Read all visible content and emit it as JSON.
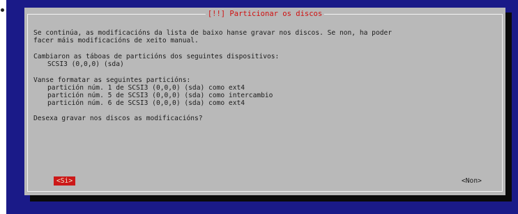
{
  "dialog": {
    "title": "[!!] Particionar os discos",
    "intro_line1": "Se continúa, as modificacións da lista de baixo hanse gravar nos discos. Se non, ha poder",
    "intro_line2": "facer máis modificacións de xeito manual.",
    "tables_heading": "Cambiaron as táboas de particións dos seguintes dispositivos:",
    "tables_device": "SCSI3 (0,0,0) (sda)",
    "format_heading": "Vanse formatar as seguintes particións:",
    "partitions": [
      "partición núm. 1 de SCSI3 (0,0,0) (sda) como ext4",
      "partición núm. 5 de SCSI3 (0,0,0) (sda) como intercambio",
      "partición núm. 6 de SCSI3 (0,0,0) (sda) como ext4"
    ],
    "question": "Desexa gravar nos discos as modificacións?",
    "yes_label": "<Si>",
    "no_label": "<Non>"
  }
}
